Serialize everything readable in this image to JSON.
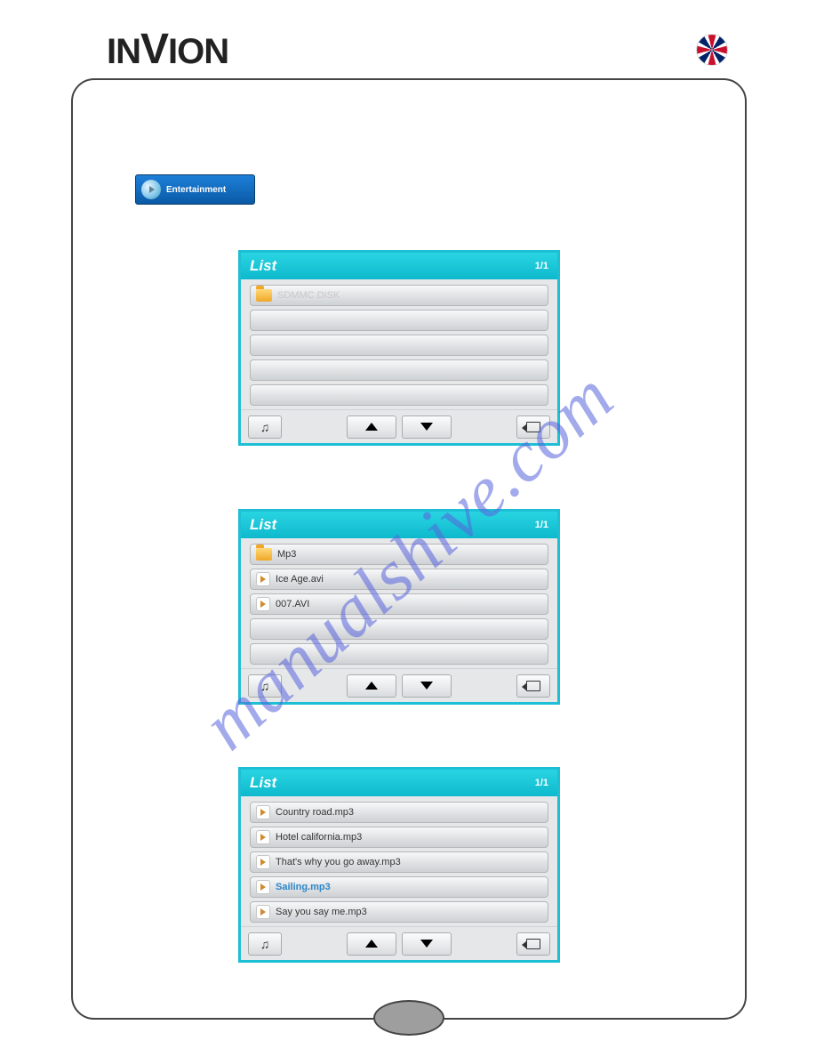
{
  "brand": "INVION",
  "entertainment_label": "Entertainment",
  "watermark": "manualshive.com",
  "panels": {
    "p1": {
      "title": "List",
      "page": "1/1",
      "rows": [
        {
          "type": "folder",
          "label": "SDMMC DISK",
          "faded": true
        },
        {
          "type": "empty"
        },
        {
          "type": "empty"
        },
        {
          "type": "empty"
        },
        {
          "type": "empty"
        }
      ]
    },
    "p2": {
      "title": "List",
      "page": "1/1",
      "rows": [
        {
          "type": "folder",
          "label": "Mp3"
        },
        {
          "type": "media",
          "label": "Ice Age.avi"
        },
        {
          "type": "media",
          "label": "007.AVI"
        },
        {
          "type": "empty"
        },
        {
          "type": "empty"
        }
      ]
    },
    "p3": {
      "title": "List",
      "page": "1/1",
      "rows": [
        {
          "type": "media",
          "label": "Country road.mp3"
        },
        {
          "type": "media",
          "label": "Hotel california.mp3"
        },
        {
          "type": "media",
          "label": "That's why you go away.mp3"
        },
        {
          "type": "media",
          "label": "Sailing.mp3",
          "selected": true
        },
        {
          "type": "media",
          "label": "Say you say me.mp3"
        }
      ]
    }
  }
}
